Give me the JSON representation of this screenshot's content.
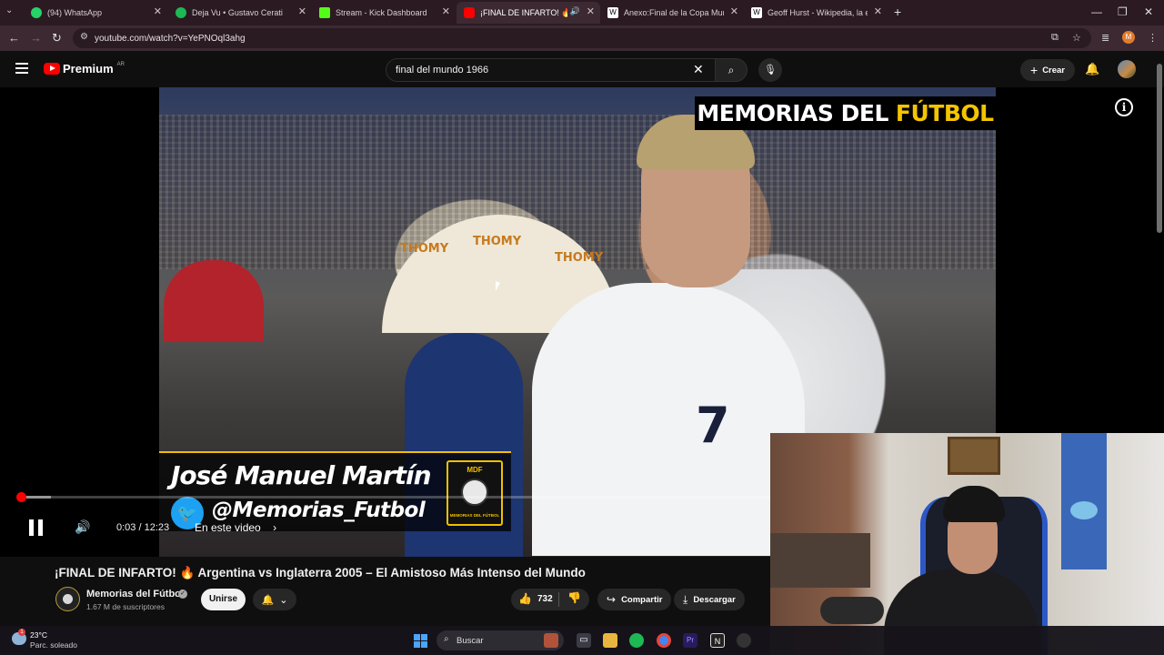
{
  "browser": {
    "tabs": [
      {
        "label": "(94) WhatsApp",
        "color": "#25d366",
        "active": false
      },
      {
        "label": "Deja Vu • Gustavo Cerati",
        "color": "#1db954",
        "active": false
      },
      {
        "label": "Stream - Kick Dashboard",
        "color": "#53fc18",
        "active": false
      },
      {
        "label": "¡FINAL DE INFARTO! 🔥 Arg",
        "color": "#ff0000",
        "active": true
      },
      {
        "label": "Anexo:Final de la Copa Mundia",
        "color": "#ffffff",
        "active": false
      },
      {
        "label": "Geoff Hurst - Wikipedia, la enc",
        "color": "#ffffff",
        "active": false
      }
    ],
    "url": "youtube.com/watch?v=YePNOql3ahg",
    "profile_initial": "M"
  },
  "youtube": {
    "brand": "Premium",
    "region": "AR",
    "search_query": "final del mundo 1966",
    "create_label": "Crear"
  },
  "video": {
    "banner_white": "MEMORIAS DEL",
    "banner_yellow": "FÚTBOL",
    "lower_third_name": "José Manuel Martín",
    "lower_third_handle": "@Memorias_Futbol",
    "badge_top": "MDF",
    "badge_bottom": "MEMORIAS DEL FÚTBOL",
    "sponsor": "THOMY",
    "jersey_number": "7",
    "progress_fraction": 0.004,
    "buffered_fraction": 0.044
  },
  "controls": {
    "timecode": "0:03 / 12:23",
    "chapter_label": "En este video"
  },
  "meta": {
    "title": "¡FINAL DE INFARTO! 🔥 Argentina vs Inglaterra 2005 – El Amistoso Más Intenso del Mundo",
    "channel": "Memorias del Fútbol",
    "subscribers": "1.67 M de suscriptores",
    "join_label": "Unirse",
    "likes": "732",
    "share_label": "Compartir",
    "download_label": "Descargar"
  },
  "taskbar": {
    "temperature": "23°C",
    "weather": "Parc. soleado",
    "search_label": "Buscar",
    "weather_badge": "1"
  }
}
